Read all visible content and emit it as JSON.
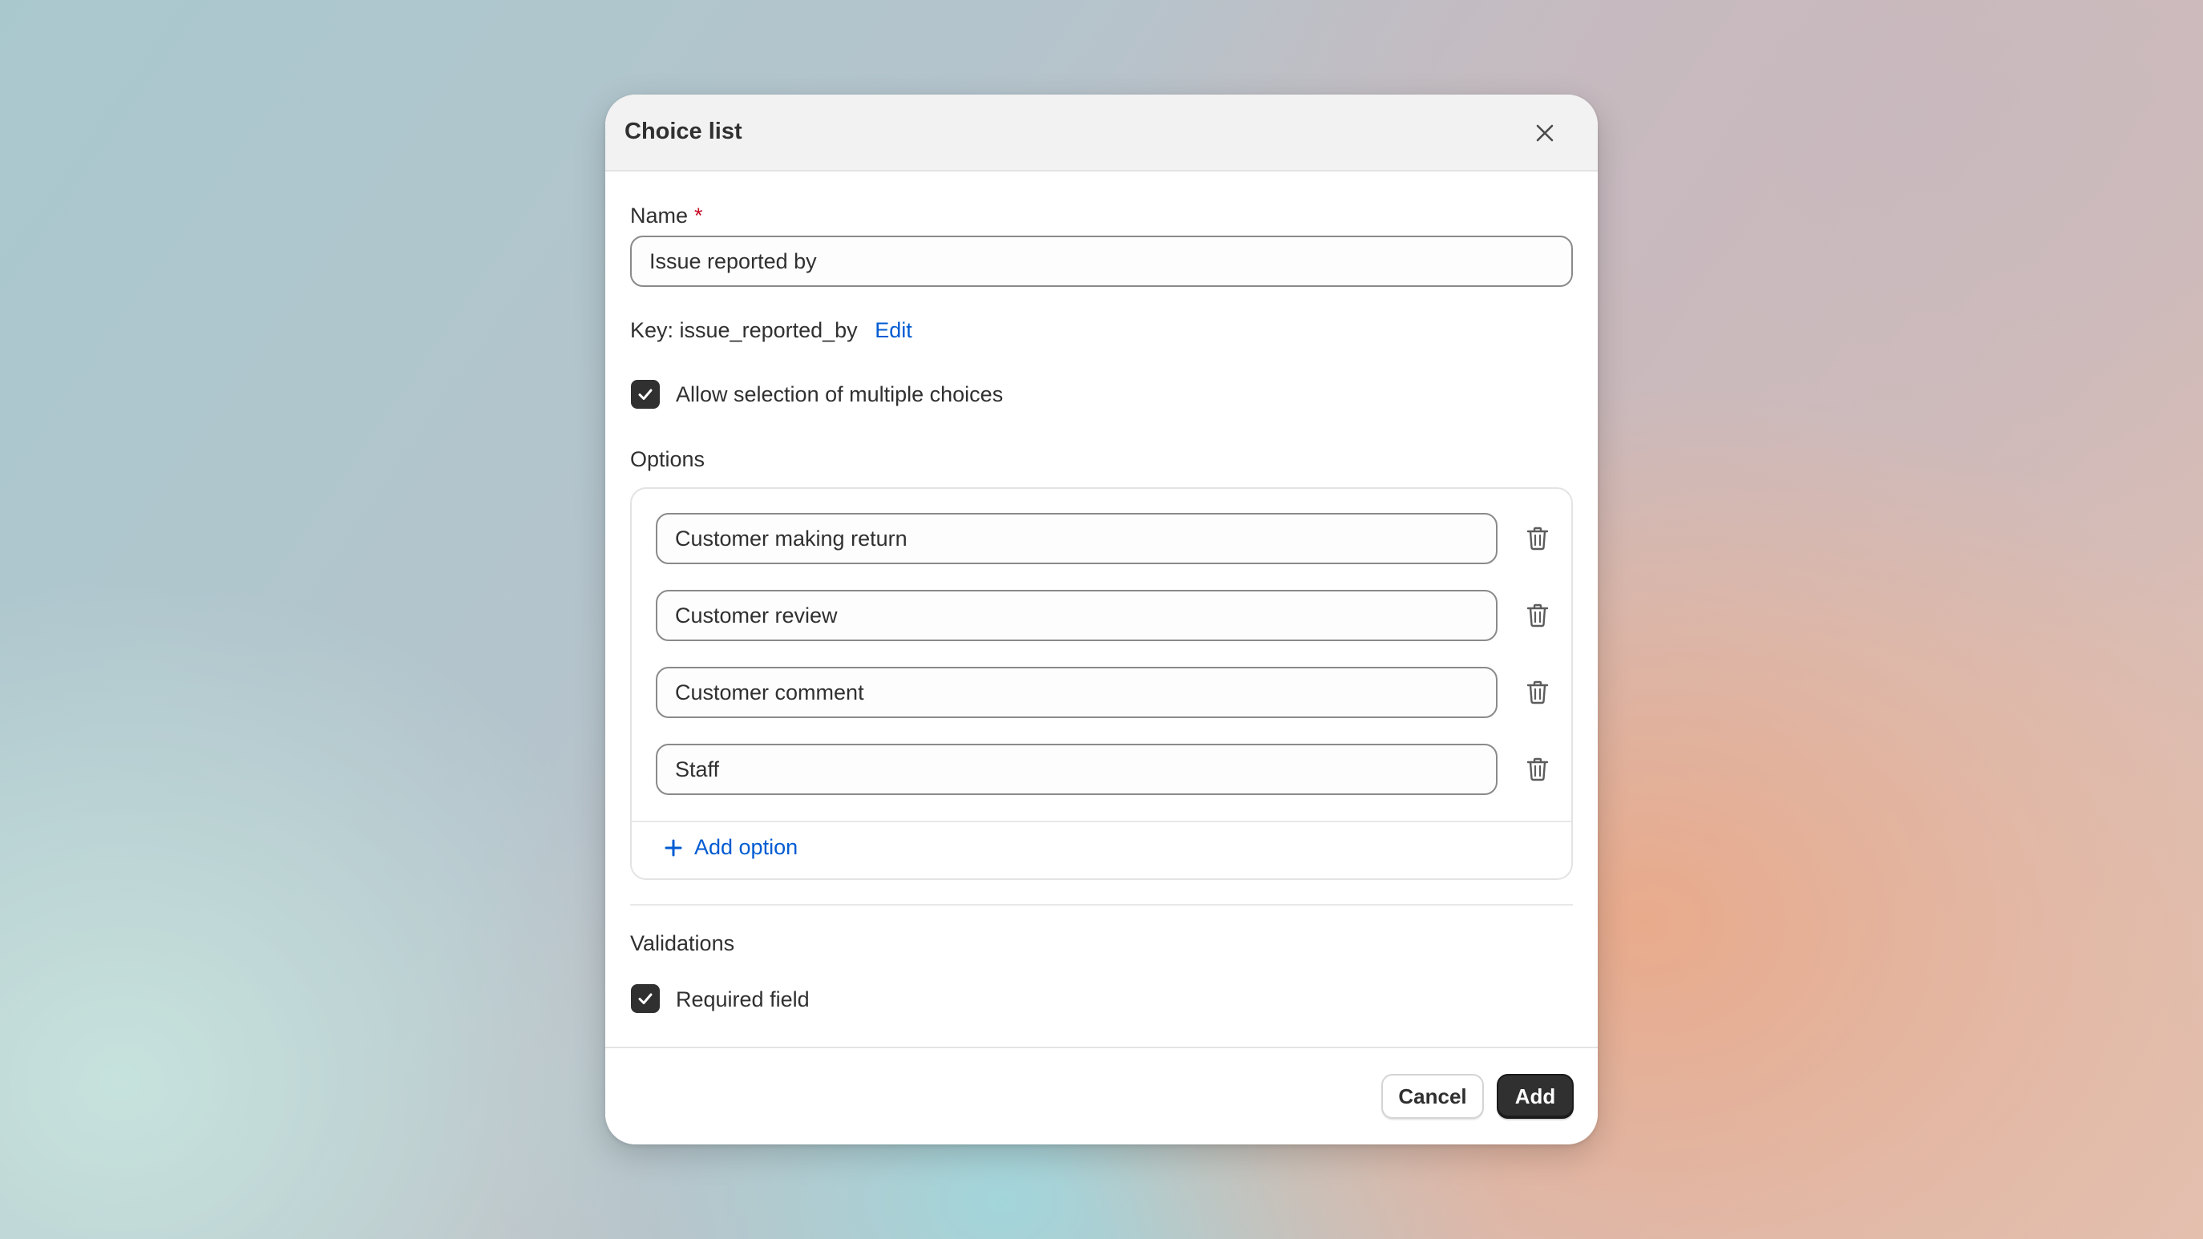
{
  "dialog": {
    "title": "Choice list",
    "close_icon": "close-icon"
  },
  "name_field": {
    "label": "Name",
    "required_marker": "*",
    "value": "Issue reported by"
  },
  "key": {
    "text": "Key: issue_reported_by",
    "edit_label": "Edit"
  },
  "multiple_choices": {
    "label": "Allow selection of multiple choices",
    "checked": true
  },
  "options": {
    "heading": "Options",
    "items": [
      {
        "value": "Customer making return",
        "delete_icon": "trash-icon"
      },
      {
        "value": "Customer review",
        "delete_icon": "trash-icon"
      },
      {
        "value": "Customer comment",
        "delete_icon": "trash-icon"
      },
      {
        "value": "Staff",
        "delete_icon": "trash-icon"
      }
    ],
    "add_label": "Add option"
  },
  "validations": {
    "heading": "Validations",
    "required_label": "Required field",
    "required_checked": true
  },
  "footer": {
    "cancel_label": "Cancel",
    "add_label": "Add"
  },
  "colors": {
    "accent_link": "#005bd3",
    "primary_button": "#303030",
    "required_star": "#c70a24"
  }
}
